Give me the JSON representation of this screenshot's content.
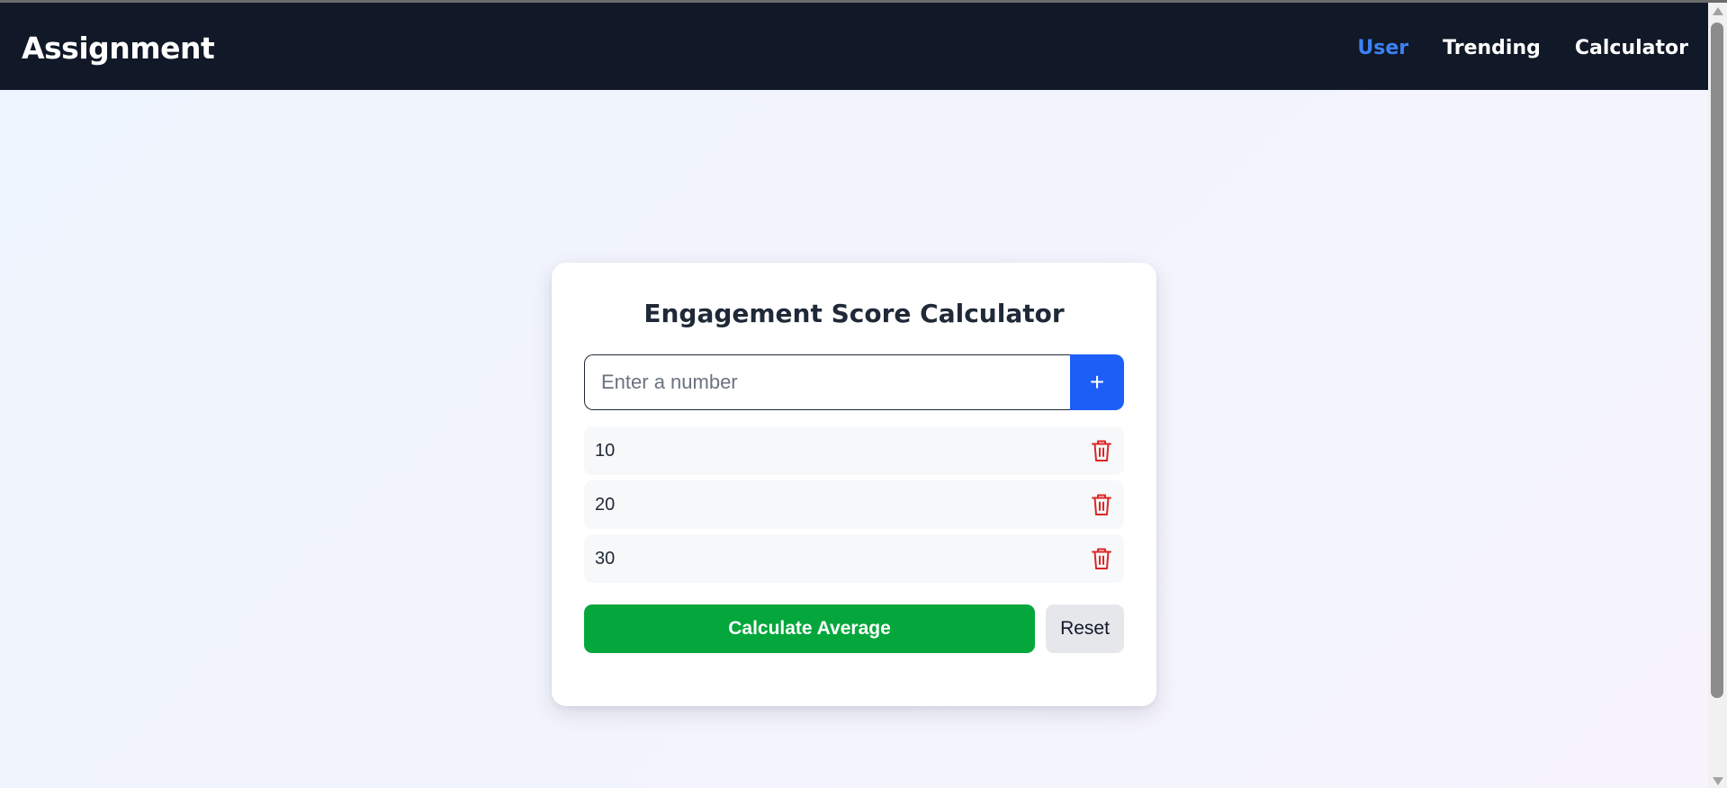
{
  "navbar": {
    "brand": "Assignment",
    "links": [
      {
        "label": "User",
        "active": true
      },
      {
        "label": "Trending",
        "active": false
      },
      {
        "label": "Calculator",
        "active": false
      }
    ]
  },
  "calculator": {
    "title": "Engagement Score Calculator",
    "input": {
      "placeholder": "Enter a number",
      "value": ""
    },
    "add_icon": "+",
    "items": [
      {
        "value": "10",
        "delete_icon": "trash-icon"
      },
      {
        "value": "20",
        "delete_icon": "trash-icon"
      },
      {
        "value": "30",
        "delete_icon": "trash-icon"
      }
    ],
    "calculate_label": "Calculate Average",
    "reset_label": "Reset"
  },
  "colors": {
    "navbar_bg": "#111827",
    "active_link": "#3b82f6",
    "add_button": "#1d5ef7",
    "calculate_button": "#05a73c",
    "reset_button": "#e5e7eb",
    "delete_icon": "#dc2626"
  }
}
